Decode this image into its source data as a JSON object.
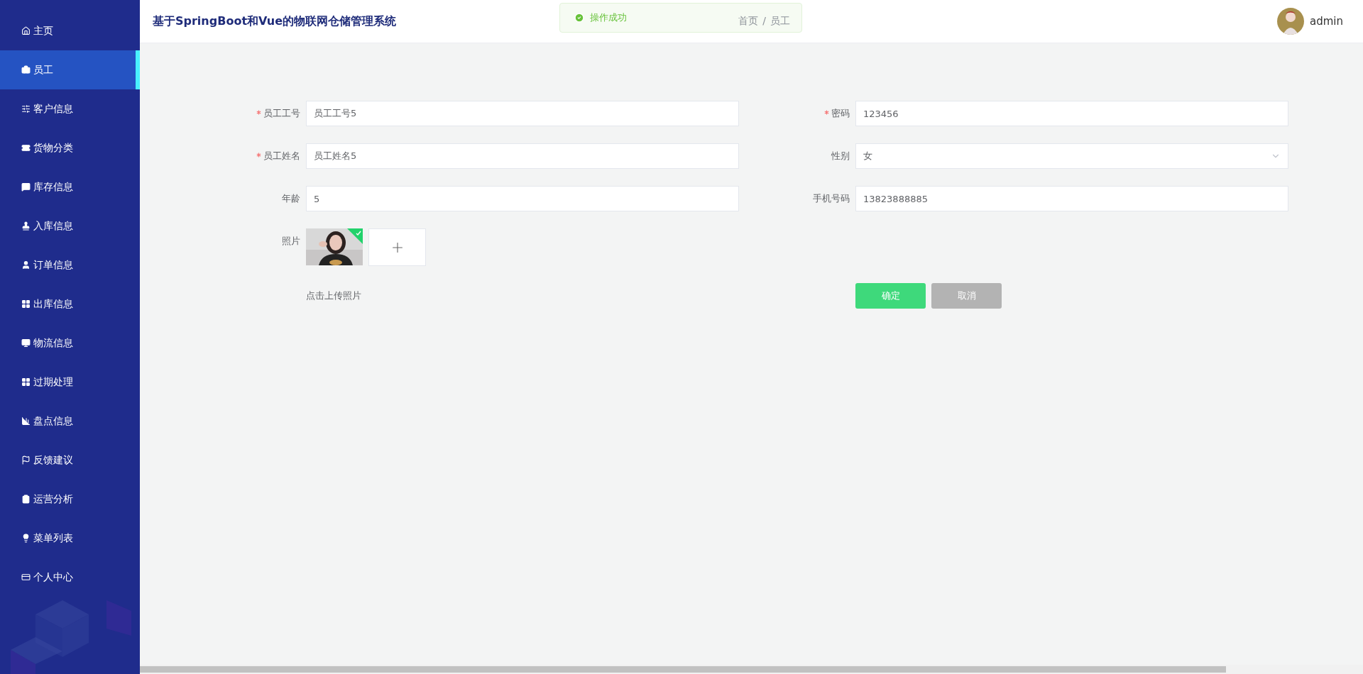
{
  "sidebar": {
    "items": [
      {
        "label": "主页",
        "selected": false
      },
      {
        "label": "员工",
        "selected": true
      },
      {
        "label": "客户信息",
        "selected": false
      },
      {
        "label": "货物分类",
        "selected": false
      },
      {
        "label": "库存信息",
        "selected": false
      },
      {
        "label": "入库信息",
        "selected": false
      },
      {
        "label": "订单信息",
        "selected": false
      },
      {
        "label": "出库信息",
        "selected": false
      },
      {
        "label": "物流信息",
        "selected": false
      },
      {
        "label": "过期处理",
        "selected": false
      },
      {
        "label": "盘点信息",
        "selected": false
      },
      {
        "label": "反馈建议",
        "selected": false
      },
      {
        "label": "运营分析",
        "selected": false
      },
      {
        "label": "菜单列表",
        "selected": false
      },
      {
        "label": "个人中心",
        "selected": false
      }
    ]
  },
  "header": {
    "title": "基于SpringBoot和Vue的物联网仓储管理系统",
    "breadcrumb": [
      "首页",
      "/",
      "员工"
    ],
    "user": "admin"
  },
  "toast": {
    "message": "操作成功"
  },
  "form": {
    "fields": [
      {
        "label": "员工工号",
        "required": true,
        "value": "员工工号5",
        "kind": "input"
      },
      {
        "label": "密码",
        "required": true,
        "value": "123456",
        "kind": "input"
      },
      {
        "label": "员工姓名",
        "required": true,
        "value": "员工姓名5",
        "kind": "input"
      },
      {
        "label": "性别",
        "required": false,
        "value": "女",
        "kind": "select"
      },
      {
        "label": "年龄",
        "required": false,
        "value": "5",
        "kind": "input"
      },
      {
        "label": "手机号码",
        "required": false,
        "value": "13823888885",
        "kind": "input"
      }
    ],
    "photo": {
      "label": "照片",
      "uploaded": true,
      "hint": "点击上传照片"
    },
    "buttons": [
      {
        "label": "确定",
        "kind": "primary"
      },
      {
        "label": "取消",
        "kind": "cancel"
      }
    ]
  }
}
